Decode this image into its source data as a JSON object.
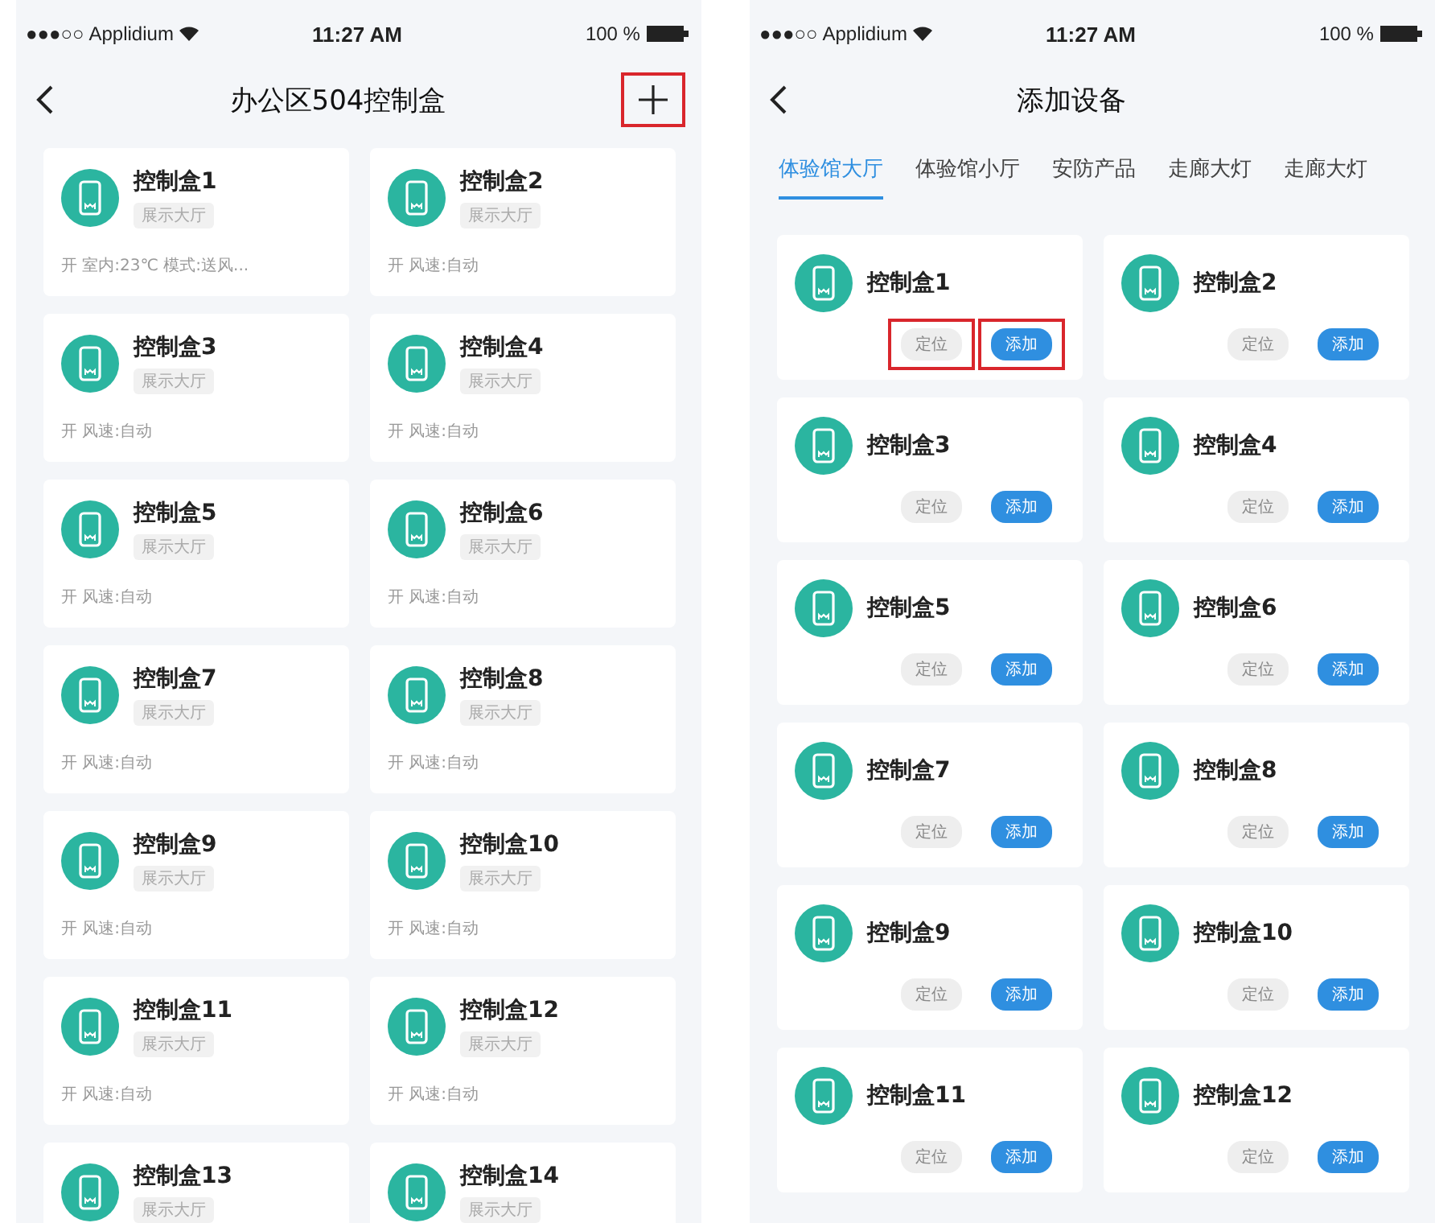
{
  "screens": [
    {
      "kind": "device_list",
      "status_bar": {
        "signal": "●●●○○",
        "carrier": "Applidium",
        "time": "11:27 AM",
        "battery": "100 %"
      },
      "title": "办公区504控制盒",
      "add_highlighted": true,
      "cards": [
        {
          "name": "控制盒1",
          "tag": "展示大厅",
          "status": "开 室内:23℃ 模式:送风..."
        },
        {
          "name": "控制盒2",
          "tag": "展示大厅",
          "status": "开 风速:自动"
        },
        {
          "name": "控制盒3",
          "tag": "展示大厅",
          "status": "开 风速:自动"
        },
        {
          "name": "控制盒4",
          "tag": "展示大厅",
          "status": "开 风速:自动"
        },
        {
          "name": "控制盒5",
          "tag": "展示大厅",
          "status": "开 风速:自动"
        },
        {
          "name": "控制盒6",
          "tag": "展示大厅",
          "status": "开 风速:自动"
        },
        {
          "name": "控制盒7",
          "tag": "展示大厅",
          "status": "开 风速:自动"
        },
        {
          "name": "控制盒8",
          "tag": "展示大厅",
          "status": "开 风速:自动"
        },
        {
          "name": "控制盒9",
          "tag": "展示大厅",
          "status": "开 风速:自动"
        },
        {
          "name": "控制盒10",
          "tag": "展示大厅",
          "status": "开 风速:自动"
        },
        {
          "name": "控制盒11",
          "tag": "展示大厅",
          "status": "开 风速:自动"
        },
        {
          "name": "控制盒12",
          "tag": "展示大厅",
          "status": "开 风速:自动"
        },
        {
          "name": "控制盒13",
          "tag": "展示大厅"
        },
        {
          "name": "控制盒14",
          "tag": "展示大厅"
        }
      ]
    },
    {
      "kind": "add_device",
      "status_bar": {
        "signal": "●●●○○",
        "carrier": "Applidium",
        "time": "11:27 AM",
        "battery": "100 %"
      },
      "title": "添加设备",
      "tabs": [
        {
          "label": "体验馆大厅",
          "selected": true
        },
        {
          "label": "体验馆小厅",
          "selected": false
        },
        {
          "label": "安防产品",
          "selected": false
        },
        {
          "label": "走廊大灯",
          "selected": false
        },
        {
          "label": "走廊大灯",
          "selected": false
        }
      ],
      "cards": [
        {
          "name": "控制盒1",
          "locate": "定位",
          "add": "添加",
          "highlighted": true
        },
        {
          "name": "控制盒2",
          "locate": "定位",
          "add": "添加",
          "highlighted": false
        },
        {
          "name": "控制盒3",
          "locate": "定位",
          "add": "添加",
          "highlighted": false
        },
        {
          "name": "控制盒4",
          "locate": "定位",
          "add": "添加",
          "highlighted": false
        },
        {
          "name": "控制盒5",
          "locate": "定位",
          "add": "添加",
          "highlighted": false
        },
        {
          "name": "控制盒6",
          "locate": "定位",
          "add": "添加",
          "highlighted": false
        },
        {
          "name": "控制盒7",
          "locate": "定位",
          "add": "添加",
          "highlighted": false
        },
        {
          "name": "控制盒8",
          "locate": "定位",
          "add": "添加",
          "highlighted": false
        },
        {
          "name": "控制盒9",
          "locate": "定位",
          "add": "添加",
          "highlighted": false
        },
        {
          "name": "控制盒10",
          "locate": "定位",
          "add": "添加",
          "highlighted": false
        },
        {
          "name": "控制盒11",
          "locate": "定位",
          "add": "添加",
          "highlighted": false
        },
        {
          "name": "控制盒12",
          "locate": "定位",
          "add": "添加",
          "highlighted": false
        }
      ]
    }
  ]
}
